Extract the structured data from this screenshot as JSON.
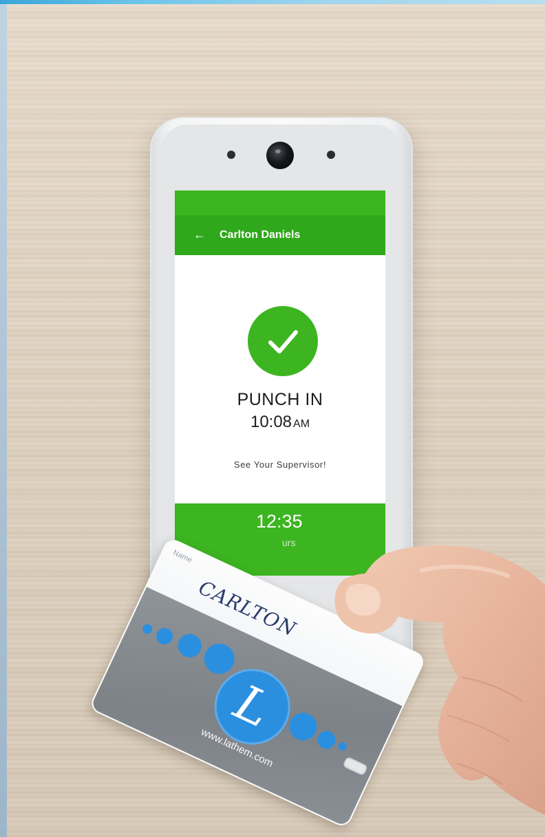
{
  "screen": {
    "header": {
      "back_icon": "arrow-left-icon",
      "employee_name": "Carlton Daniels"
    },
    "status_icon": "checkmark-icon",
    "punch_label": "PUNCH IN",
    "punch_time": "10:08",
    "punch_ampm": "AM",
    "message": "See Your Supervisor!",
    "footer": {
      "time": "12:35",
      "sub_fragment": "urs"
    }
  },
  "badge": {
    "name_label": "Name",
    "handwritten_name": "CARLTON",
    "logo_letter": "L",
    "url": "www.lathem.com"
  },
  "colors": {
    "accent_green": "#3cb521",
    "app_bar_green": "#2fa81c",
    "badge_blue": "#2b8fe0",
    "badge_gray": "#8f9499"
  }
}
